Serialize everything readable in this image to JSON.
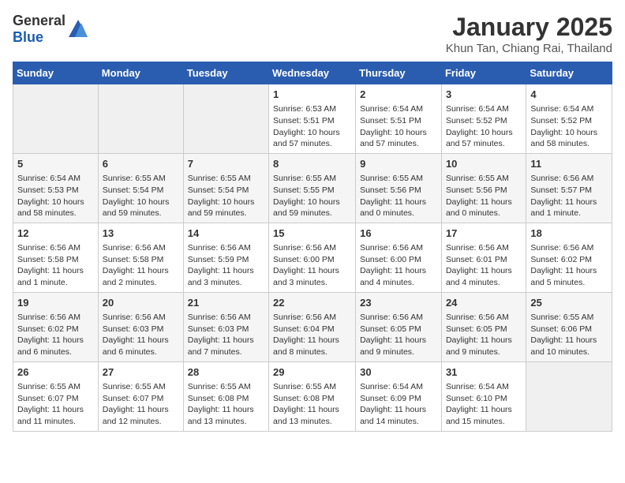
{
  "header": {
    "logo_general": "General",
    "logo_blue": "Blue",
    "title": "January 2025",
    "subtitle": "Khun Tan, Chiang Rai, Thailand"
  },
  "weekdays": [
    "Sunday",
    "Monday",
    "Tuesday",
    "Wednesday",
    "Thursday",
    "Friday",
    "Saturday"
  ],
  "weeks": [
    [
      {
        "day": "",
        "info": ""
      },
      {
        "day": "",
        "info": ""
      },
      {
        "day": "",
        "info": ""
      },
      {
        "day": "1",
        "info": "Sunrise: 6:53 AM\nSunset: 5:51 PM\nDaylight: 10 hours\nand 57 minutes."
      },
      {
        "day": "2",
        "info": "Sunrise: 6:54 AM\nSunset: 5:51 PM\nDaylight: 10 hours\nand 57 minutes."
      },
      {
        "day": "3",
        "info": "Sunrise: 6:54 AM\nSunset: 5:52 PM\nDaylight: 10 hours\nand 57 minutes."
      },
      {
        "day": "4",
        "info": "Sunrise: 6:54 AM\nSunset: 5:52 PM\nDaylight: 10 hours\nand 58 minutes."
      }
    ],
    [
      {
        "day": "5",
        "info": "Sunrise: 6:54 AM\nSunset: 5:53 PM\nDaylight: 10 hours\nand 58 minutes."
      },
      {
        "day": "6",
        "info": "Sunrise: 6:55 AM\nSunset: 5:54 PM\nDaylight: 10 hours\nand 59 minutes."
      },
      {
        "day": "7",
        "info": "Sunrise: 6:55 AM\nSunset: 5:54 PM\nDaylight: 10 hours\nand 59 minutes."
      },
      {
        "day": "8",
        "info": "Sunrise: 6:55 AM\nSunset: 5:55 PM\nDaylight: 10 hours\nand 59 minutes."
      },
      {
        "day": "9",
        "info": "Sunrise: 6:55 AM\nSunset: 5:56 PM\nDaylight: 11 hours\nand 0 minutes."
      },
      {
        "day": "10",
        "info": "Sunrise: 6:55 AM\nSunset: 5:56 PM\nDaylight: 11 hours\nand 0 minutes."
      },
      {
        "day": "11",
        "info": "Sunrise: 6:56 AM\nSunset: 5:57 PM\nDaylight: 11 hours\nand 1 minute."
      }
    ],
    [
      {
        "day": "12",
        "info": "Sunrise: 6:56 AM\nSunset: 5:58 PM\nDaylight: 11 hours\nand 1 minute."
      },
      {
        "day": "13",
        "info": "Sunrise: 6:56 AM\nSunset: 5:58 PM\nDaylight: 11 hours\nand 2 minutes."
      },
      {
        "day": "14",
        "info": "Sunrise: 6:56 AM\nSunset: 5:59 PM\nDaylight: 11 hours\nand 3 minutes."
      },
      {
        "day": "15",
        "info": "Sunrise: 6:56 AM\nSunset: 6:00 PM\nDaylight: 11 hours\nand 3 minutes."
      },
      {
        "day": "16",
        "info": "Sunrise: 6:56 AM\nSunset: 6:00 PM\nDaylight: 11 hours\nand 4 minutes."
      },
      {
        "day": "17",
        "info": "Sunrise: 6:56 AM\nSunset: 6:01 PM\nDaylight: 11 hours\nand 4 minutes."
      },
      {
        "day": "18",
        "info": "Sunrise: 6:56 AM\nSunset: 6:02 PM\nDaylight: 11 hours\nand 5 minutes."
      }
    ],
    [
      {
        "day": "19",
        "info": "Sunrise: 6:56 AM\nSunset: 6:02 PM\nDaylight: 11 hours\nand 6 minutes."
      },
      {
        "day": "20",
        "info": "Sunrise: 6:56 AM\nSunset: 6:03 PM\nDaylight: 11 hours\nand 6 minutes."
      },
      {
        "day": "21",
        "info": "Sunrise: 6:56 AM\nSunset: 6:03 PM\nDaylight: 11 hours\nand 7 minutes."
      },
      {
        "day": "22",
        "info": "Sunrise: 6:56 AM\nSunset: 6:04 PM\nDaylight: 11 hours\nand 8 minutes."
      },
      {
        "day": "23",
        "info": "Sunrise: 6:56 AM\nSunset: 6:05 PM\nDaylight: 11 hours\nand 9 minutes."
      },
      {
        "day": "24",
        "info": "Sunrise: 6:56 AM\nSunset: 6:05 PM\nDaylight: 11 hours\nand 9 minutes."
      },
      {
        "day": "25",
        "info": "Sunrise: 6:55 AM\nSunset: 6:06 PM\nDaylight: 11 hours\nand 10 minutes."
      }
    ],
    [
      {
        "day": "26",
        "info": "Sunrise: 6:55 AM\nSunset: 6:07 PM\nDaylight: 11 hours\nand 11 minutes."
      },
      {
        "day": "27",
        "info": "Sunrise: 6:55 AM\nSunset: 6:07 PM\nDaylight: 11 hours\nand 12 minutes."
      },
      {
        "day": "28",
        "info": "Sunrise: 6:55 AM\nSunset: 6:08 PM\nDaylight: 11 hours\nand 13 minutes."
      },
      {
        "day": "29",
        "info": "Sunrise: 6:55 AM\nSunset: 6:08 PM\nDaylight: 11 hours\nand 13 minutes."
      },
      {
        "day": "30",
        "info": "Sunrise: 6:54 AM\nSunset: 6:09 PM\nDaylight: 11 hours\nand 14 minutes."
      },
      {
        "day": "31",
        "info": "Sunrise: 6:54 AM\nSunset: 6:10 PM\nDaylight: 11 hours\nand 15 minutes."
      },
      {
        "day": "",
        "info": ""
      }
    ]
  ]
}
